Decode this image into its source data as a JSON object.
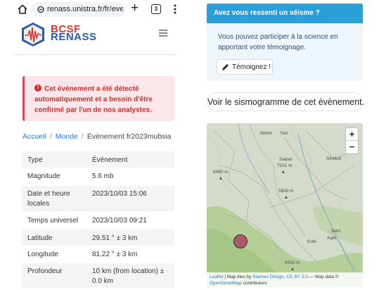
{
  "browser": {
    "url": "renass.unistra.fr/fr/even",
    "tab_count": "3"
  },
  "site": {
    "logo_line1": "BCSF",
    "logo_line2": "RENASS"
  },
  "alert": {
    "text": "Cet évènement a été détecté automatiquement et a besoin d'être confirmé par l'un de nos analystes."
  },
  "breadcrumb": {
    "home": "Accueil",
    "region": "Monde",
    "current": "Évènement fr2023mubsia"
  },
  "details": [
    {
      "key": "Type",
      "value": "Évènement"
    },
    {
      "key": "Magnitude",
      "value": "5.6 mb"
    },
    {
      "key": "Date et heure locales",
      "value": "2023/10/03 15:06"
    },
    {
      "key": "Temps universel",
      "value": "2023/10/03 09:21"
    },
    {
      "key": "Latitude",
      "value": "29.51 ° ± 3 km"
    },
    {
      "key": "Longitude",
      "value": "81.22 ° ± 3 km"
    },
    {
      "key": "Profondeur",
      "value": "10 km (from location) ± 0.0 km"
    }
  ],
  "felt_card": {
    "title": "Avez vous ressenti un séisme ?",
    "body": "Vous pouvez participer à la science en apportant votre témoignage.",
    "button": "Témoignez !"
  },
  "seismogram_button": "Voir le sismogramme de cet évènement.",
  "map": {
    "zoom_in": "+",
    "zoom_out": "−",
    "labels": {
      "nhem": "Nhem",
      "yari": "Yari",
      "saipal": "Saipal",
      "saipal_alt": "7031 m",
      "simikot": "Simikot",
      "alt_6480": "6480 m",
      "alt_5900": "5900 m",
      "sehi": "Sehi",
      "aam": "Aam",
      "kolti": "Kolti",
      "alt_4350": "4350 m"
    },
    "attribution": {
      "leaflet": "Leaflet",
      "tiles_prefix": " | Map tiles by ",
      "stamen": "Stamen Design",
      "sep": ", ",
      "ccby": "CC BY 3.0",
      "data": " — Map data © ",
      "osm": "OpenStreetMap",
      "contrib": " contributors"
    },
    "colors": {
      "marker": "#a85a6a",
      "terrain": "#cfd9c0",
      "lowland": "#a9c98a"
    }
  },
  "colors": {
    "accent": "#2a9fd8",
    "alert_text": "#c9302c",
    "link": "#2f78c4"
  }
}
